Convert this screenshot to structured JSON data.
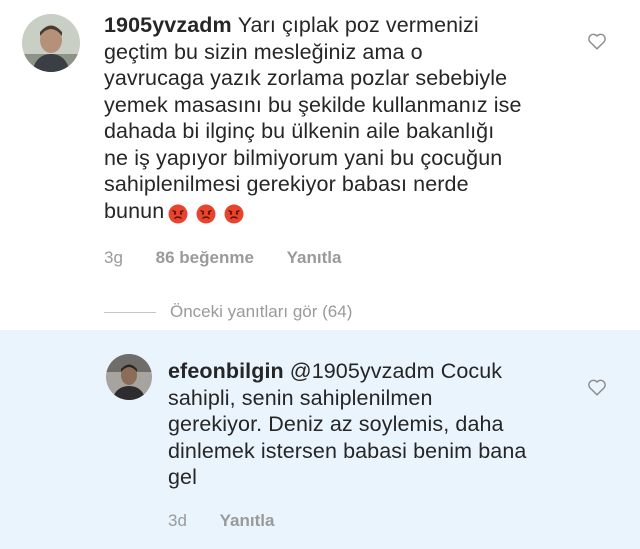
{
  "comment1": {
    "username": "1905yvzadm",
    "text_lines": [
      "Yarı çıplak poz vermenizi",
      "geçtim bu sizin mesleğiniz ama o",
      "yavrucaga yazık zorlama pozlar sebebiyle",
      "yemek masasını bu şekilde kullanmanız ise",
      "dahada bi ilginç bu ülkenin aile bakanlığı",
      "ne iş yapıyor bilmiyorum yani bu çocuğun",
      "sahiplenilmesi gerekiyor babası nerde",
      "bunun"
    ],
    "emoji": [
      "angry-face",
      "angry-face",
      "angry-face"
    ],
    "time": "3g",
    "likes": "86 beğenme",
    "reply_label": "Yanıtla"
  },
  "view_replies": "Önceki yanıtları gör (64)",
  "comment2": {
    "username": "efeonbilgin",
    "mention": "@1905yvzadm",
    "text_lines": [
      "Cocuk",
      "sahipli, senin sahiplenilmen",
      "gerekiyor. Deniz az soylemis, daha",
      "dinlemek istersen babasi benim bana",
      "gel"
    ],
    "time": "3d",
    "reply_label": "Yanıtla"
  },
  "colors": {
    "highlight_bg": "#eaf4fd",
    "meta_text": "#9a9a9a",
    "main_text": "#262626",
    "emoji_red": "#e8432e"
  }
}
